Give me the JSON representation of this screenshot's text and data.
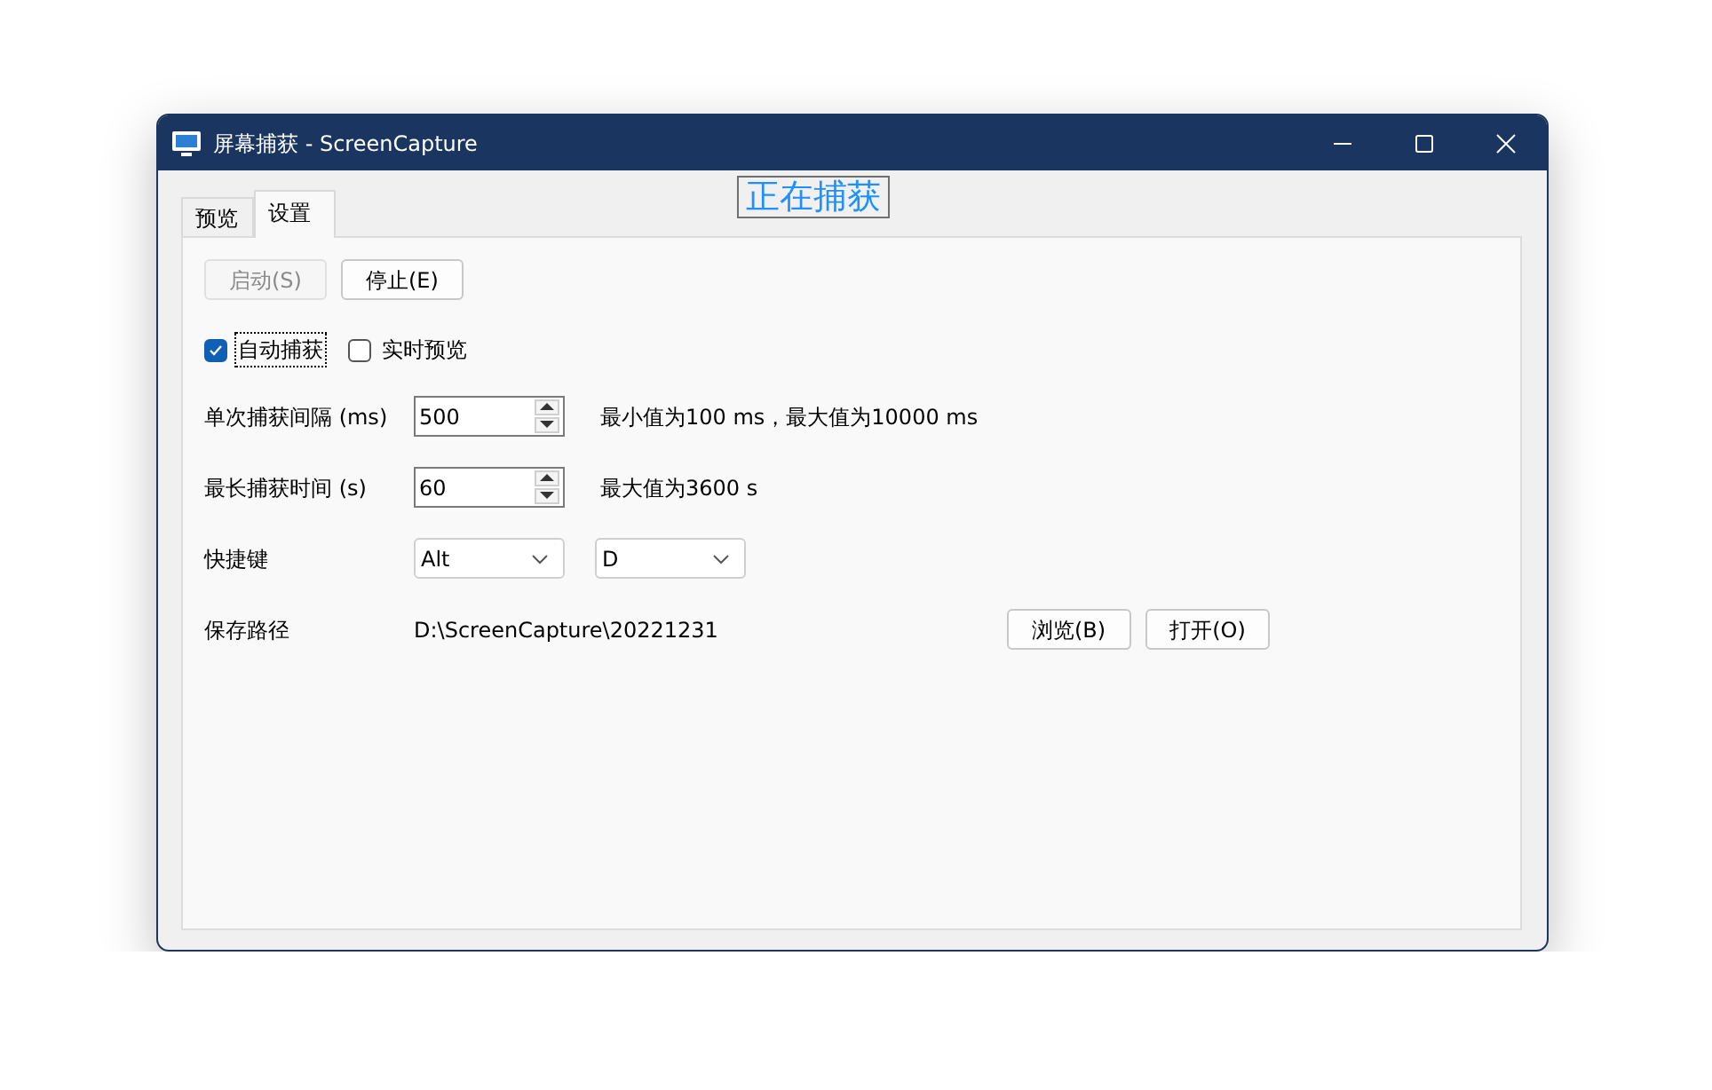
{
  "window": {
    "title": "屏幕捕获 - ScreenCapture"
  },
  "tabs": [
    {
      "label": "预览",
      "selected": false
    },
    {
      "label": "设置",
      "selected": true
    }
  ],
  "status": "正在捕获",
  "buttons": [
    {
      "label": "启动(S)",
      "disabled": true
    },
    {
      "label": "停止(E)",
      "disabled": false
    }
  ],
  "checkboxes": [
    {
      "label": "自动捕获",
      "checked": true,
      "focused": true
    },
    {
      "label": "实时预览",
      "checked": false,
      "focused": false
    }
  ],
  "settings": [
    {
      "kind": "spin",
      "label": "单次捕获间隔 (ms)",
      "value": "500",
      "hint": "最小值为100 ms，最大值为10000 ms"
    },
    {
      "kind": "spin",
      "label": "最长捕获时间 (s)",
      "value": "60",
      "hint": "最大值为3600 s"
    },
    {
      "kind": "combos",
      "label": "快捷键",
      "options": [
        "Alt",
        "D"
      ]
    },
    {
      "kind": "path",
      "label": "保存路径",
      "value": "D:\\ScreenCapture\\20221231",
      "buttons": [
        "浏览(B)",
        "打开(O)"
      ]
    }
  ]
}
